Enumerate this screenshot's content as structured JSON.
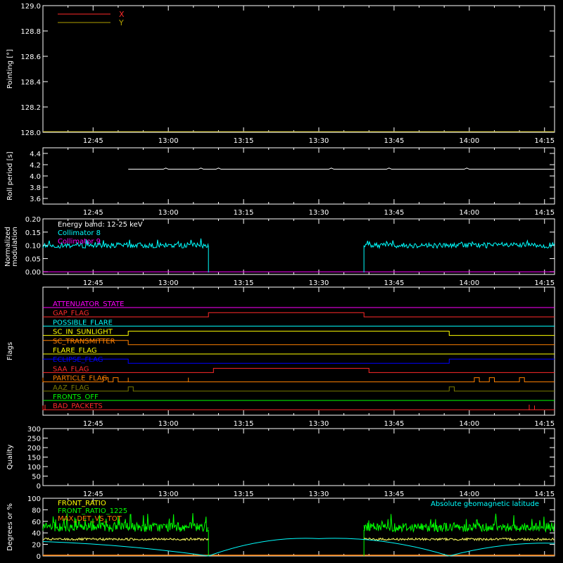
{
  "time_axis": {
    "ticks": [
      "12:45",
      "13:00",
      "13:15",
      "13:30",
      "13:45",
      "14:00",
      "14:15"
    ],
    "range": [
      "12:35",
      "14:17"
    ]
  },
  "colors": {
    "background": "#000000",
    "axes": "#ffffff",
    "red": "#ff2a2a",
    "olive": "#b0a000",
    "cyan": "#00ffff",
    "magenta": "#ff00ff",
    "yellow": "#ffff00",
    "orange": "#ff8000",
    "blue": "#0000ff",
    "green": "#00ff00",
    "dark_olive": "#7a7a00",
    "pale_yellow": "#ffff60"
  },
  "chart_data": [
    {
      "id": "pointing",
      "type": "line",
      "ylabel": "Pointing [°]",
      "ylim": [
        128.0,
        129.0
      ],
      "yticks": [
        "128.0",
        "128.2",
        "128.4",
        "128.6",
        "128.8",
        "129.0"
      ],
      "series": [
        {
          "name": "X",
          "color": "#ff2a2a",
          "values": []
        },
        {
          "name": "Y",
          "color": "#b0a000",
          "values": []
        }
      ]
    },
    {
      "id": "roll_period",
      "type": "line",
      "ylabel": "Roll period [s]",
      "ylim": [
        3.5,
        4.5
      ],
      "yticks": [
        "3.6",
        "3.8",
        "4.0",
        "4.2",
        "4.4"
      ],
      "series": [
        {
          "color": "#ffffff",
          "x": [
            "12:35",
            "13:00",
            "13:15",
            "13:30",
            "13:45",
            "14:00",
            "14:17"
          ],
          "y": [
            4.12,
            4.12,
            4.12,
            4.12,
            4.12,
            4.12,
            4.12
          ]
        }
      ]
    },
    {
      "id": "modulation",
      "type": "line",
      "ylabel": "Normalized modulation",
      "ylim": [
        -0.01,
        0.2
      ],
      "yticks": [
        "0.00",
        "0.05",
        "0.10",
        "0.15",
        "0.20"
      ],
      "annotation": "Energy band: 12-25 keV",
      "series": [
        {
          "name": "Collimator 8",
          "color": "#00ffff",
          "segments": [
            {
              "from": "12:35",
              "to": "13:08",
              "level": 0.1,
              "spread": 0.01
            },
            {
              "from": "13:39",
              "to": "14:17",
              "level": 0.1,
              "spread": 0.01
            }
          ]
        },
        {
          "name": "Collimator 9",
          "color": "#ff00ff",
          "level": 0.0
        }
      ]
    },
    {
      "id": "flags",
      "type": "line",
      "ylabel": "Flags",
      "series": [
        {
          "name": "ATTENUATOR_STATE",
          "color": "#ff00ff",
          "steps": [
            [
              "12:35",
              0
            ]
          ]
        },
        {
          "name": "GAP_FLAG",
          "color": "#ff2a2a",
          "steps": [
            [
              "12:35",
              0
            ],
            [
              "13:08",
              1
            ],
            [
              "13:39",
              0
            ]
          ]
        },
        {
          "name": "POSSIBLE_FLARE",
          "color": "#00ffff",
          "steps": [
            [
              "12:35",
              0
            ]
          ]
        },
        {
          "name": "SC_IN_SUNLIGHT",
          "color": "#ffff00",
          "steps": [
            [
              "12:35",
              0
            ],
            [
              "12:52",
              1
            ],
            [
              "13:56",
              0
            ]
          ]
        },
        {
          "name": "SC_TRANSMITTER",
          "color": "#ff8000",
          "steps": [
            [
              "12:35",
              1
            ],
            [
              "12:52",
              0
            ]
          ]
        },
        {
          "name": "FLARE_FLAG",
          "color": "#ffff00",
          "steps": [
            [
              "12:35",
              0
            ]
          ]
        },
        {
          "name": "ECLIPSE_FLAG",
          "color": "#0000ff",
          "steps": [
            [
              "12:35",
              1
            ],
            [
              "12:52",
              0
            ],
            [
              "13:56",
              1
            ]
          ]
        },
        {
          "name": "SAA_FLAG",
          "color": "#ff2a2a",
          "steps": [
            [
              "12:35",
              0
            ],
            [
              "13:09",
              1
            ],
            [
              "13:40",
              0
            ]
          ]
        },
        {
          "name": "PARTICLE_FLAG",
          "color": "#ff8000",
          "steps": [
            [
              "12:35",
              1
            ],
            [
              "12:35",
              0
            ],
            [
              "12:47",
              1
            ],
            [
              "12:48",
              0
            ],
            [
              "12:49",
              1
            ],
            [
              "12:50",
              0
            ],
            [
              "12:52",
              1
            ],
            [
              "12:52",
              0
            ],
            [
              "13:04",
              1
            ],
            [
              "13:04",
              0
            ],
            [
              "14:01",
              1
            ],
            [
              "14:02",
              0
            ],
            [
              "14:04",
              1
            ],
            [
              "14:05",
              0
            ],
            [
              "14:10",
              1
            ],
            [
              "14:11",
              0
            ]
          ]
        },
        {
          "name": "AAZ_FLAG",
          "color": "#7a7a00",
          "steps": [
            [
              "12:35",
              0
            ],
            [
              "12:52",
              1
            ],
            [
              "12:53",
              0
            ],
            [
              "13:56",
              1
            ],
            [
              "13:57",
              0
            ]
          ]
        },
        {
          "name": "FRONTS_OFF",
          "color": "#00ff00",
          "steps": [
            [
              "12:35",
              0
            ]
          ]
        },
        {
          "name": "BAD_PACKETS",
          "color": "#ff2a2a",
          "steps": [
            [
              "12:35",
              1
            ],
            [
              "12:35",
              0
            ],
            [
              "14:13",
              1
            ],
            [
              "14:13",
              0
            ]
          ]
        }
      ]
    },
    {
      "id": "quality",
      "type": "line",
      "ylabel": "Quality",
      "ylim": [
        0,
        300
      ],
      "yticks": [
        "0",
        "50",
        "100",
        "150",
        "200",
        "250",
        "300"
      ],
      "series": []
    },
    {
      "id": "fronts",
      "type": "line",
      "ylabel": "Degrees or %",
      "ylim": [
        0,
        100
      ],
      "yticks": [
        "0",
        "20",
        "40",
        "60",
        "80",
        "100"
      ],
      "annotation": "Absolute geomagnetic latitude",
      "series": [
        {
          "name": "FRONT_RATIO",
          "color": "#ffff60",
          "segments": [
            {
              "from": "12:35",
              "to": "13:08",
              "level": 29,
              "spread": 2
            },
            {
              "from": "13:39",
              "to": "14:17",
              "level": 29,
              "spread": 2
            }
          ]
        },
        {
          "name": "FRONT_RATIO_1225",
          "color": "#00ff00",
          "segments": [
            {
              "from": "12:35",
              "to": "13:08",
              "level": 50,
              "spread": 8
            },
            {
              "from": "13:39",
              "to": "14:17",
              "level": 50,
              "spread": 8
            }
          ]
        },
        {
          "name": "MAX_DET_VS_TOT",
          "color": "#ff8000",
          "level": 0
        },
        {
          "name": "Absolute geomagnetic latitude",
          "color": "#00ffff",
          "x": [
            "12:35",
            "12:52",
            "13:08",
            "13:30",
            "13:56",
            "14:17"
          ],
          "y": [
            25,
            15,
            0,
            30,
            0,
            22
          ]
        }
      ]
    }
  ]
}
